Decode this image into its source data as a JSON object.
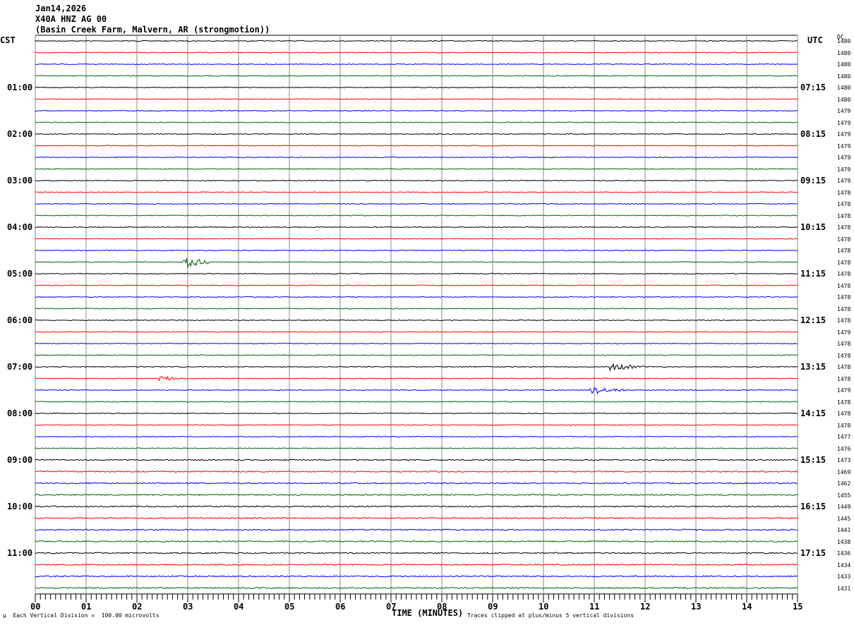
{
  "header": {
    "date": "Jan14,2026",
    "station": "X40A HNZ AG 00",
    "location": "(Basin Creek Farm, Malvern, AR (strongmotion))"
  },
  "chart_data": {
    "type": "line",
    "title": "Jan14,2026 X40A HNZ AG 00",
    "xlabel": "TIME (MINUTES)",
    "xlim": [
      0,
      15
    ],
    "x_ticks": [
      "00",
      "01",
      "02",
      "03",
      "04",
      "05",
      "06",
      "07",
      "08",
      "09",
      "10",
      "11",
      "12",
      "13",
      "14",
      "15"
    ],
    "left_axis_label": "CST",
    "right_axis_label": "UTC",
    "dc_label": "DC",
    "left_hour_labels": [
      "01:00",
      "02:00",
      "03:00",
      "04:00",
      "05:00",
      "06:00",
      "07:00",
      "08:00",
      "09:00",
      "10:00",
      "11:00"
    ],
    "right_hour_labels": [
      "07:15",
      "08:15",
      "09:15",
      "10:15",
      "11:15",
      "12:15",
      "13:15",
      "14:15",
      "15:15",
      "16:15",
      "17:15"
    ],
    "trace_colors": [
      "#000000",
      "#ff0000",
      "#0000ff",
      "#006400"
    ],
    "trace_count": 48,
    "dc_values": [
      1480,
      1480,
      1480,
      1480,
      1480,
      1480,
      1479,
      1479,
      1479,
      1479,
      1479,
      1479,
      1479,
      1478,
      1478,
      1478,
      1478,
      1478,
      1478,
      1478,
      1478,
      1478,
      1478,
      1478,
      1478,
      1479,
      1478,
      1478,
      1478,
      1478,
      1479,
      1478,
      1478,
      1478,
      1477,
      1476,
      1473,
      1469,
      1462,
      1455,
      1449,
      1445,
      1441,
      1438,
      1436,
      1434,
      1433,
      1431
    ],
    "events": [
      {
        "trace": 19,
        "start_min": 2.9,
        "end_min": 3.4,
        "amplitude_div": 1.2
      },
      {
        "trace": 28,
        "start_min": 11.3,
        "end_min": 12.0,
        "amplitude_div": 0.6
      },
      {
        "trace": 29,
        "start_min": 2.4,
        "end_min": 3.0,
        "amplitude_div": 0.4
      },
      {
        "trace": 30,
        "start_min": 10.9,
        "end_min": 11.6,
        "amplitude_div": 0.7
      }
    ],
    "scale_note": "Each Vertical Division =  100.00 microvolts",
    "clip_note": "Traces clipped at plus/minus 5 vertical divisions"
  }
}
